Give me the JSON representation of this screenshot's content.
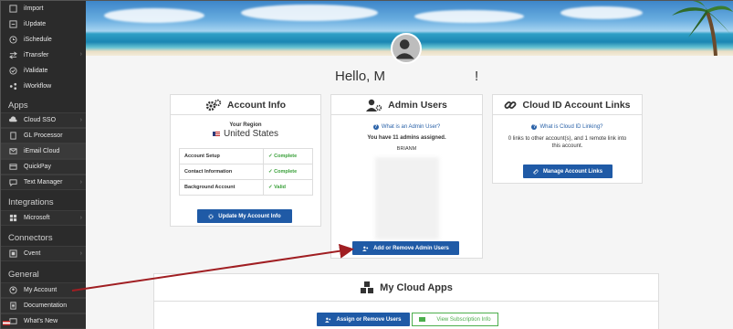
{
  "sidebar": {
    "top_items": [
      {
        "label": "iImport",
        "icon": "import-icon"
      },
      {
        "label": "iUpdate",
        "icon": "update-icon"
      },
      {
        "label": "iSchedule",
        "icon": "schedule-icon"
      },
      {
        "label": "iTransfer",
        "icon": "transfer-icon"
      },
      {
        "label": "iValidate",
        "icon": "validate-icon"
      },
      {
        "label": "iWorkflow",
        "icon": "workflow-icon"
      }
    ],
    "sections": {
      "apps": "Apps",
      "integrations": "Integrations",
      "connectors": "Connectors",
      "general": "General"
    },
    "apps_items": [
      {
        "label": "Cloud SSO"
      },
      {
        "label": "GL Processor"
      },
      {
        "label": "iEmail Cloud"
      },
      {
        "label": "QuickPay"
      },
      {
        "label": "Text Manager"
      }
    ],
    "integrations_items": [
      {
        "label": "Microsoft"
      }
    ],
    "connectors_items": [
      {
        "label": "Cvent"
      }
    ],
    "general_items": [
      {
        "label": "My Account"
      },
      {
        "label": "Documentation"
      },
      {
        "label": "What's New"
      }
    ]
  },
  "greeting": {
    "hello": "Hello, M",
    "suffix": "!"
  },
  "account_info": {
    "title": "Account Info",
    "region_label": "Your Region",
    "region_value": "United States",
    "rows": [
      {
        "label": "Account Setup",
        "status": "Complete"
      },
      {
        "label": "Contact Information",
        "status": "Complete"
      },
      {
        "label": "Background Account",
        "status": "Valid"
      }
    ],
    "button": "Update My Account Info"
  },
  "admin_users": {
    "title": "Admin Users",
    "help_link": "What is an Admin User?",
    "count_text": "You have 11 admins assigned.",
    "first_admin": "BRIANM",
    "button": "Add or Remove Admin Users"
  },
  "cloud_links": {
    "title": "Cloud ID Account Links",
    "help_link": "What is Cloud ID Linking?",
    "description": "0 links to other account(s), and 1 remote link into this account.",
    "button": "Manage Account Links"
  },
  "cloud_apps": {
    "title": "My Cloud Apps",
    "assign_button": "Assign or Remove Users",
    "subscription_button": "View Subscription Info"
  },
  "colors": {
    "accent": "#1f5aa6",
    "success": "#3aa03a",
    "annotation": "#a01e22"
  }
}
